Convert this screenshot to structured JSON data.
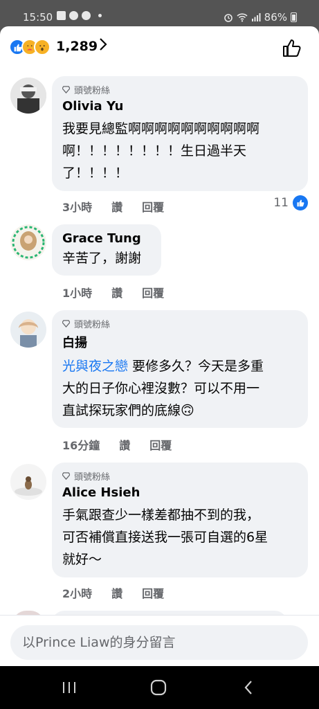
{
  "status": {
    "time": "15:50",
    "battery": "86%"
  },
  "reactions": {
    "count": "1,289",
    "icons": [
      "like-icon",
      "care-icon",
      "wow-icon"
    ]
  },
  "comments": [
    {
      "badge": "頭號粉絲",
      "name": "Olivia Yu",
      "text_lines": [
        "我要見總監啊啊啊啊啊啊啊啊啊啊",
        "啊！！！！！！！！生日過半天",
        "了！！！！"
      ],
      "time": "3小時",
      "like": "讚",
      "reply": "回覆",
      "likes": "11"
    },
    {
      "badge": "",
      "name": "Grace Tung",
      "text_lines": [
        "辛苦了，謝謝"
      ],
      "time": "1小時",
      "like": "讚",
      "reply": "回覆"
    },
    {
      "badge": "頭號粉絲",
      "name": "白揚",
      "mention": "光與夜之戀",
      "text_lines": [
        " 要修多久？今天是多重",
        "大的日子你心裡沒數？可以不用一",
        "直試探玩家們的底線🙃"
      ],
      "time": "16分鐘",
      "like": "讚",
      "reply": "回覆"
    },
    {
      "badge": "頭號粉絲",
      "name": "Alice Hsieh",
      "text_lines": [
        "手氣跟查少一樣差都抽不到的我，",
        "可否補償直接送我一張可自選的6星",
        "就好〜"
      ],
      "time": "2小時",
      "like": "讚",
      "reply": "回覆"
    }
  ],
  "composer": {
    "placeholder": "以Prince Liaw的身分留言"
  },
  "colors": {
    "accent": "#1877f2",
    "bubble": "#f0f2f5",
    "meta": "#65676b"
  }
}
